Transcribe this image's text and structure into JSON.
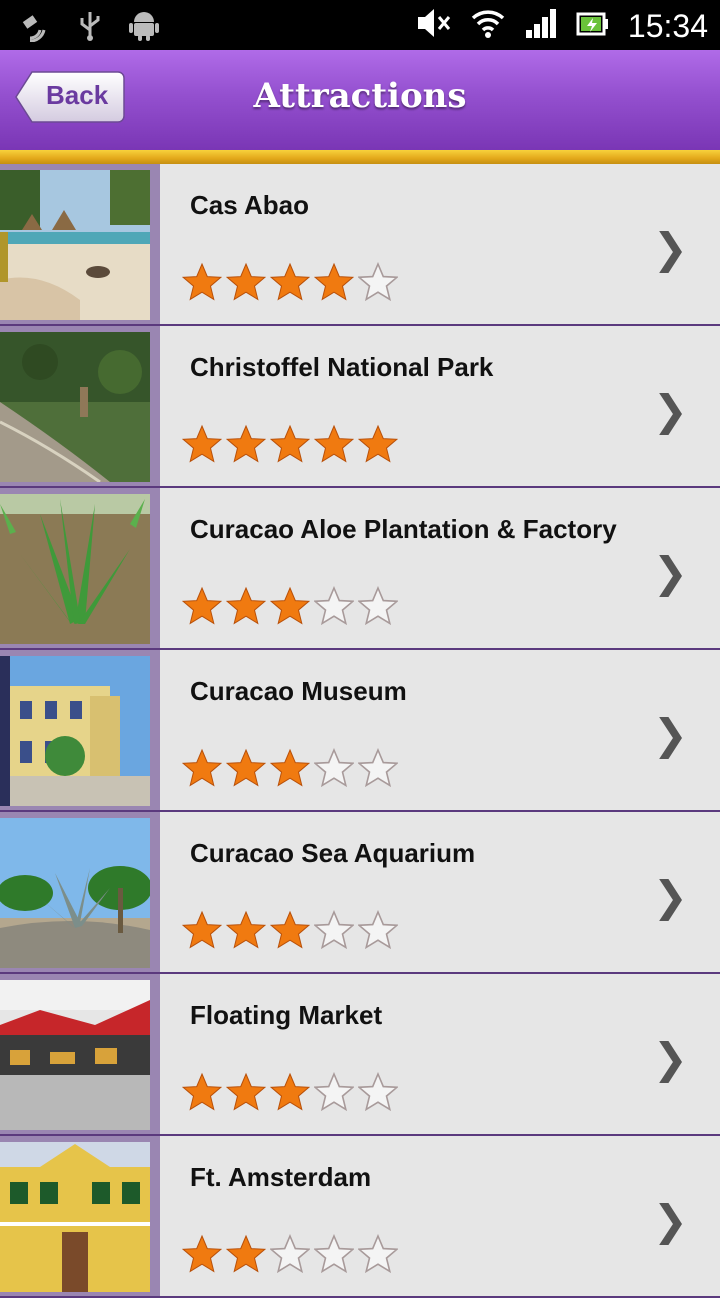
{
  "status_bar": {
    "time": "15:34",
    "icons": [
      "gps-icon",
      "usb-icon",
      "android-icon",
      "mute-icon",
      "wifi-icon",
      "signal-icon",
      "battery-icon"
    ]
  },
  "header": {
    "back_label": "Back",
    "title": "Attractions",
    "colors": {
      "bar": "#9450cf",
      "stripe": "#f0c22c",
      "back_text": "#6a3aa0"
    }
  },
  "items": [
    {
      "title": "Cas Abao",
      "rating": 4,
      "thumbnail": "beach-photo"
    },
    {
      "title": "Christoffel National Park",
      "rating": 5,
      "thumbnail": "park-trail-photo"
    },
    {
      "title": "Curacao Aloe Plantation & Factory",
      "rating": 3,
      "thumbnail": "aloe-field-photo"
    },
    {
      "title": "Curacao Museum",
      "rating": 3,
      "thumbnail": "museum-building-photo"
    },
    {
      "title": "Curacao Sea Aquarium",
      "rating": 3,
      "thumbnail": "palm-trees-photo"
    },
    {
      "title": "Floating Market",
      "rating": 3,
      "thumbnail": "market-stalls-photo"
    },
    {
      "title": "Ft. Amsterdam",
      "rating": 2,
      "thumbnail": "fort-building-photo"
    }
  ],
  "max_rating": 5,
  "colors": {
    "star_filled": "#f07a10",
    "star_empty_outline": "#a89a9a",
    "chevron": "#555555"
  }
}
